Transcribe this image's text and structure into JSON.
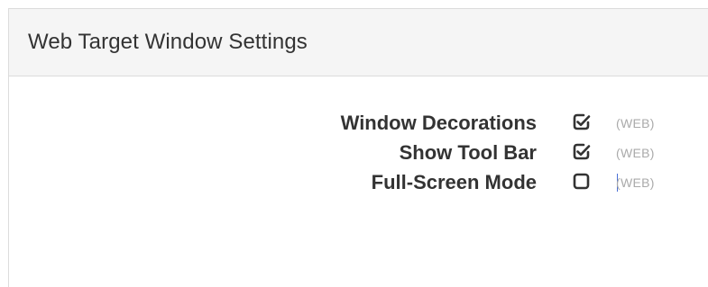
{
  "panel": {
    "title": "Web Target Window Settings"
  },
  "settings": [
    {
      "label": "Window Decorations",
      "checked": true,
      "scope": "(WEB)"
    },
    {
      "label": "Show Tool Bar",
      "checked": true,
      "scope": "(WEB)"
    },
    {
      "label": "Full-Screen Mode",
      "checked": false,
      "scope": "(WEB)"
    }
  ],
  "colors": {
    "text": "#333333",
    "muted": "#aaaaaa",
    "header_bg": "#f5f5f5",
    "border": "#dcdcdc",
    "caret": "#4a6fd6"
  },
  "icons": {
    "checked": "checkbox-checked-icon",
    "unchecked": "checkbox-unchecked-icon"
  }
}
